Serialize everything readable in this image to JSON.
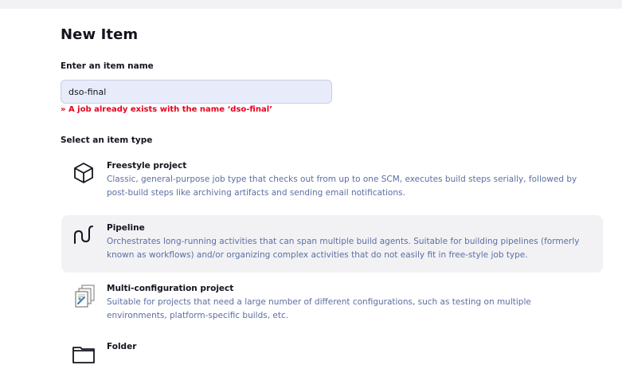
{
  "page": {
    "title": "New Item"
  },
  "name_field": {
    "label": "Enter an item name",
    "value": "dso-final",
    "error": "» A job already exists with the name ‘dso-final’"
  },
  "item_types": {
    "label": "Select an item type",
    "items": [
      {
        "name": "Freestyle project",
        "icon": "package-box-icon",
        "description": "Classic, general-purpose job type that checks out from up to one SCM, executes build steps serially, followed by post-build steps like archiving artifacts and sending email notifications."
      },
      {
        "name": "Pipeline",
        "icon": "pipeline-icon",
        "description": "Orchestrates long-running activities that can span multiple build agents. Suitable for building pipelines (formerly known as workflows) and/or organizing complex activities that do not easily fit in free-style job type.",
        "selected": true
      },
      {
        "name": "Multi-configuration project",
        "icon": "multi-configuration-icon",
        "description": "Suitable for projects that need a large number of different configurations, such as testing on multiple environments, platform-specific builds, etc."
      },
      {
        "name": "Folder",
        "icon": "folder-icon",
        "description": ""
      }
    ]
  },
  "colors": {
    "error": "#e6001e",
    "description": "#5c6fa3",
    "selected_background": "#f2f2f5",
    "input_background": "#e8ebfa"
  }
}
